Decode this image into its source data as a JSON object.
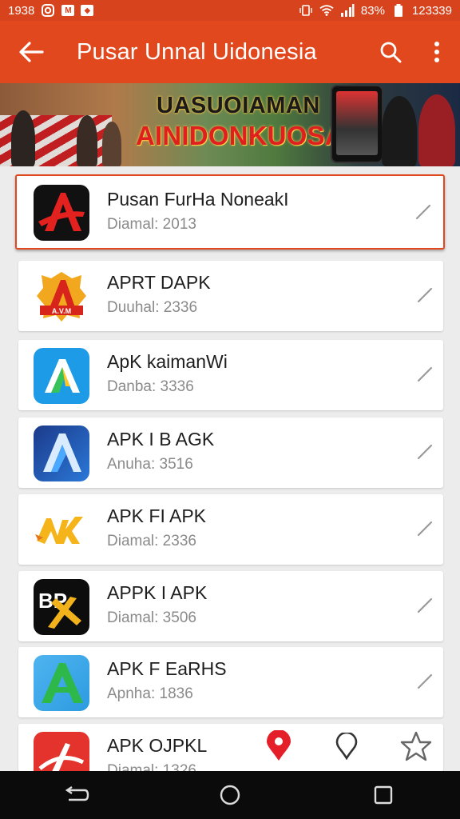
{
  "status_bar": {
    "time": "1938",
    "battery": "83%",
    "clock_right": "123339"
  },
  "app_bar": {
    "title": "Pusar Unnal Uidonesia"
  },
  "banner": {
    "line1": "UASUOIAMAN",
    "line2": "AINIDONKUOSA"
  },
  "apps": [
    {
      "name": "Pusan FurHa NoneakI",
      "meta": "Diamal: 2013",
      "icon": "red-a-icon"
    },
    {
      "name": "APRT DAPK",
      "meta": "Duuhal: 2336",
      "icon": "flame-a-badge-icon"
    },
    {
      "name": "ApK kaimanWi",
      "meta": "Danba: 3336",
      "icon": "blue-a-icon"
    },
    {
      "name": "APK I B AGK",
      "meta": "Anuha: 3516",
      "icon": "navy-a-icon"
    },
    {
      "name": "APK FI APK",
      "meta": "Diamal: 2336",
      "icon": "yellow-apk-icon"
    },
    {
      "name": "APPK I APK",
      "meta": "Diamal: 3506",
      "icon": "black-bx-icon"
    },
    {
      "name": "APK F EaRHS",
      "meta": "Apnha: 1836",
      "icon": "green-a-icon"
    },
    {
      "name": "APK OJPKL",
      "meta": "Diamal: 1326",
      "icon": "red-stripe-icon"
    }
  ],
  "colors": {
    "primary": "#e2481d",
    "status": "#d6431c",
    "card_border": "#e2481d"
  }
}
